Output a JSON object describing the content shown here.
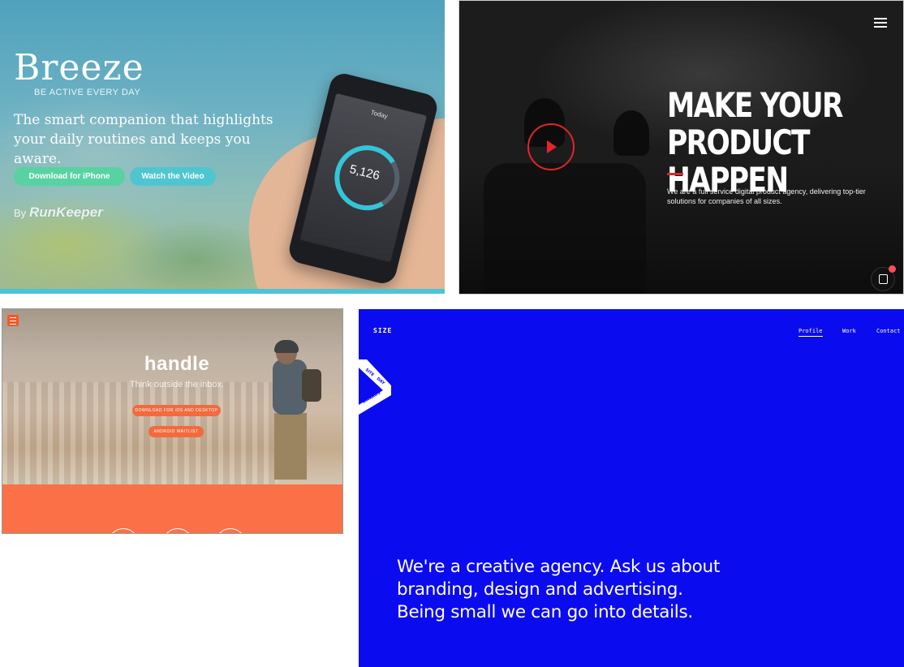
{
  "breeze": {
    "logo": "Breeze",
    "tagline": "BE ACTIVE EVERY DAY",
    "headline": "The smart companion that highlights your daily routines and keeps you aware.",
    "download_button": "Download for iPhone",
    "video_button": "Watch the Video",
    "by_label": "By",
    "partner": "RunKeeper",
    "phone": {
      "steps": "5,126",
      "screen_title": "Today"
    },
    "colors": {
      "download": "#58d2a3",
      "video": "#4fc6cf",
      "bar": "#4cc3d6"
    }
  },
  "agency": {
    "headline_line1": "MAKE YOUR",
    "headline_line2": "PRODUCT HAPPEN",
    "description": "We are a full service digital product agency, delivering top-tier solutions for companies of all sizes.",
    "icons": {
      "menu": "hamburger-menu-icon",
      "play": "play-icon",
      "chat": "chat-icon"
    },
    "colors": {
      "accent": "#e3242b",
      "chat_dot": "#ff4d5a"
    }
  },
  "handle": {
    "title": "handle",
    "subtitle": "Think outside the inbox.",
    "ios_button": "DOWNLOAD FOR iOS AND DESKTOP",
    "android_button": "ANDROID WAITLIST",
    "colors": {
      "accent": "#fb7046",
      "button": "#f36a3e"
    }
  },
  "size": {
    "logo": "SIZE",
    "nav": [
      "Profile",
      "Work",
      "Contact"
    ],
    "active_nav": "Profile",
    "award_ribbon": [
      "SITE",
      "DAY",
      "AWARDS"
    ],
    "copy_line1": "We're a creative agency. Ask us about",
    "copy_line2": "branding, design and advertising.",
    "copy_line3": "Being small we can go into details.",
    "colors": {
      "background": "#0b0bf0"
    }
  }
}
